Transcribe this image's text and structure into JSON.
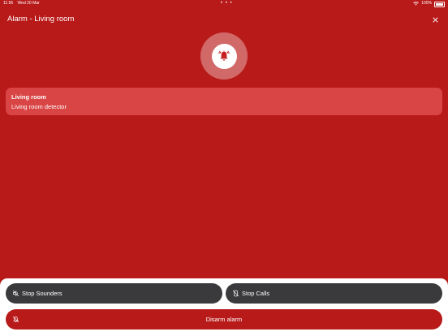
{
  "status_bar": {
    "time": "11:56",
    "date": "Wed 20 Mar",
    "battery": "100%",
    "dots": "• • •"
  },
  "header": {
    "title": "Alarm - Living room",
    "close_icon": "close-icon"
  },
  "alarm": {
    "icon": "alarm-bell-icon",
    "colors": {
      "icon_red": "#c62020",
      "ring": "rgba(255,255,255,0.35)"
    }
  },
  "detector": {
    "room": "Living room",
    "name": "Living room detector"
  },
  "actions": {
    "stop_sounders": "Stop Sounders",
    "stop_calls": "Stop Calls",
    "disarm": "Disarm alarm"
  },
  "colors": {
    "background": "#b81a1a",
    "card": "#d94444",
    "dark_button": "#3a3a3c"
  }
}
